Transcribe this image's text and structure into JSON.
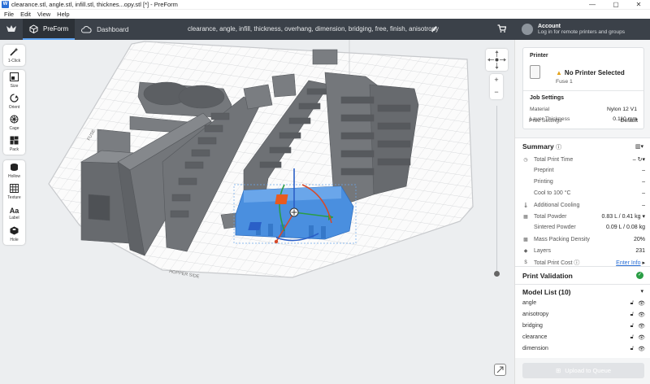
{
  "window": {
    "title": "clearance.stl, angle.stl, infill.stl, thicknes...opy.stl [*] - PreForm",
    "controls": [
      "—",
      "▢",
      "✕"
    ]
  },
  "menu": [
    "File",
    "Edit",
    "View",
    "Help"
  ],
  "header": {
    "tabs": [
      {
        "label": "PreForm",
        "active": true
      },
      {
        "label": "Dashboard",
        "active": false
      }
    ],
    "filenames": "clearance, angle, infill, thickness, overhang, dimension, bridging, free, finish, anisotropy"
  },
  "account": {
    "title": "Account",
    "subtitle": "Log in for remote printers and groups"
  },
  "toolbar": [
    {
      "label": "1-Click",
      "icon": "magic-wand-icon"
    },
    {
      "label": "Size",
      "icon": "size-icon"
    },
    {
      "label": "Orient",
      "icon": "orient-icon"
    },
    {
      "label": "Cage",
      "icon": "cage-icon"
    },
    {
      "label": "Pack",
      "icon": "pack-icon"
    },
    {
      "label": "Hollow",
      "icon": "hollow-icon"
    },
    {
      "label": "Texture",
      "icon": "texture-icon"
    },
    {
      "label": "Label",
      "icon": "label-icon"
    },
    {
      "label": "Hole",
      "icon": "hole-icon"
    }
  ],
  "viewport": {
    "zoom_in": "+",
    "zoom_out": "−",
    "bed_label_front": "HOPPER SIDE",
    "bed_label_left": "FUSE"
  },
  "printer": {
    "heading": "Printer",
    "status": "No Printer Selected",
    "model": "Fuse 1"
  },
  "job": {
    "heading": "Job Settings",
    "rows": [
      {
        "key": "Material",
        "value": "Nylon 12 V1"
      },
      {
        "key": "Layer Thickness",
        "value": "0.110 mm"
      },
      {
        "key": "Print Settings",
        "value": "Default"
      }
    ]
  },
  "summary": {
    "heading": "Summary",
    "rows": [
      {
        "key": "Total Print Time",
        "value": "–",
        "icon": "clock-icon",
        "sub": false
      },
      {
        "key": "Preprint",
        "value": "–",
        "icon": "",
        "sub": true
      },
      {
        "key": "Printing",
        "value": "–",
        "icon": "",
        "sub": true
      },
      {
        "key": "Cool to 100 °C",
        "value": "–",
        "icon": "",
        "sub": true
      },
      {
        "key": "Additional Cooling",
        "value": "–",
        "icon": "thermometer-icon",
        "sub": false
      },
      {
        "key": "Total Powder",
        "value": "0.83 L / 0.41 kg",
        "icon": "powder-icon",
        "sub": false
      },
      {
        "key": "Sintered Powder",
        "value": "0.09 L / 0.08 kg",
        "icon": "",
        "sub": true
      },
      {
        "key": "Mass Packing Density",
        "value": "20%",
        "icon": "density-icon",
        "sub": false
      },
      {
        "key": "Layers",
        "value": "231",
        "icon": "layers-icon",
        "sub": false
      },
      {
        "key": "Total Print Cost",
        "value": "Enter Info",
        "icon": "dollar-icon",
        "sub": false
      }
    ]
  },
  "validation": {
    "label": "Print Validation",
    "status_color": "#2a9d45"
  },
  "model_list": {
    "heading": "Model List (10)",
    "items": [
      "angle",
      "anisotropy",
      "bridging",
      "clearance",
      "dimension"
    ]
  },
  "upload_button": "Upload to Queue",
  "colors": {
    "accent": "#5ea2ef",
    "header_bg": "#3b4149",
    "selected_model": "#4a8fdf",
    "part_gray": "#6b6e72"
  }
}
